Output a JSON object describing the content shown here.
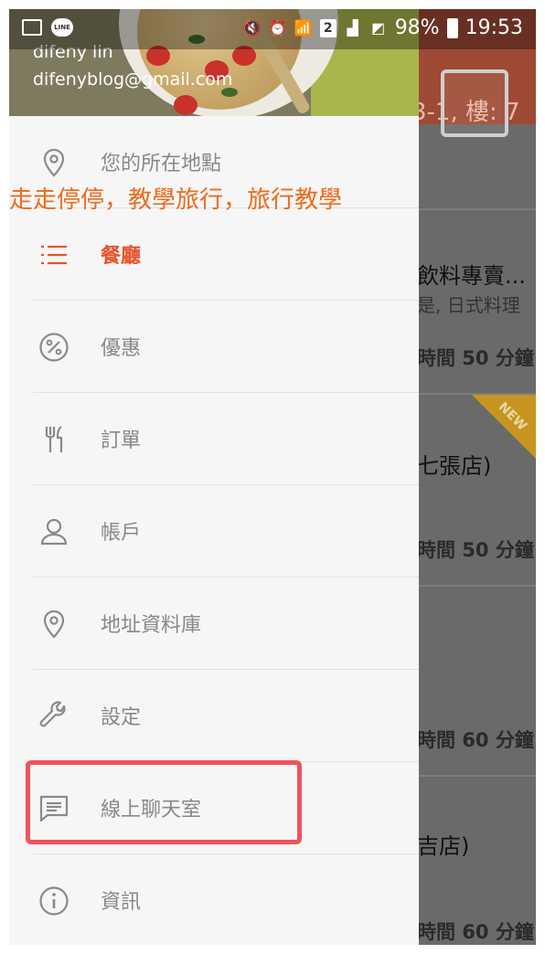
{
  "status_bar": {
    "line_label": "LINE",
    "sim_slot": "2",
    "battery": "98%",
    "time": "19:53"
  },
  "background": {
    "address_partial": "3-1, 樓: 7",
    "restaurants": [
      {
        "name_partial": "飲料專賣...",
        "category_partial": "是, 日式料理",
        "time_partial": "時間 50 分鐘"
      },
      {
        "name_partial": "七張店)",
        "time_partial": "時間 50 分鐘",
        "badge": "NEW"
      },
      {
        "time_partial": "時間 60 分鐘"
      },
      {
        "name_partial": "吉店)",
        "time_partial": "時間 60 分鐘"
      }
    ]
  },
  "drawer": {
    "user_name": "difeny lin",
    "user_email": "difenyblog@gmail.com",
    "menu": [
      {
        "label": "您的所在地點",
        "icon": "location-pin-icon",
        "active": false
      },
      {
        "label": "餐廳",
        "icon": "list-icon",
        "active": true
      },
      {
        "label": "優惠",
        "icon": "percent-icon",
        "active": false
      },
      {
        "label": "訂單",
        "icon": "fork-knife-icon",
        "active": false
      },
      {
        "label": "帳戶",
        "icon": "person-icon",
        "active": false
      },
      {
        "label": "地址資料庫",
        "icon": "location-pin-icon",
        "active": false
      },
      {
        "label": "設定",
        "icon": "wrench-icon",
        "active": false
      },
      {
        "label": "線上聊天室",
        "icon": "chat-icon",
        "active": false
      },
      {
        "label": "資訊",
        "icon": "info-icon",
        "active": false
      }
    ]
  },
  "overlay": {
    "watermark": "走走停停，教學旅行，旅行教學"
  },
  "colors": {
    "accent": "#e5552d",
    "highlight_box": "#f2525c",
    "watermark": "#ee6a1c"
  }
}
